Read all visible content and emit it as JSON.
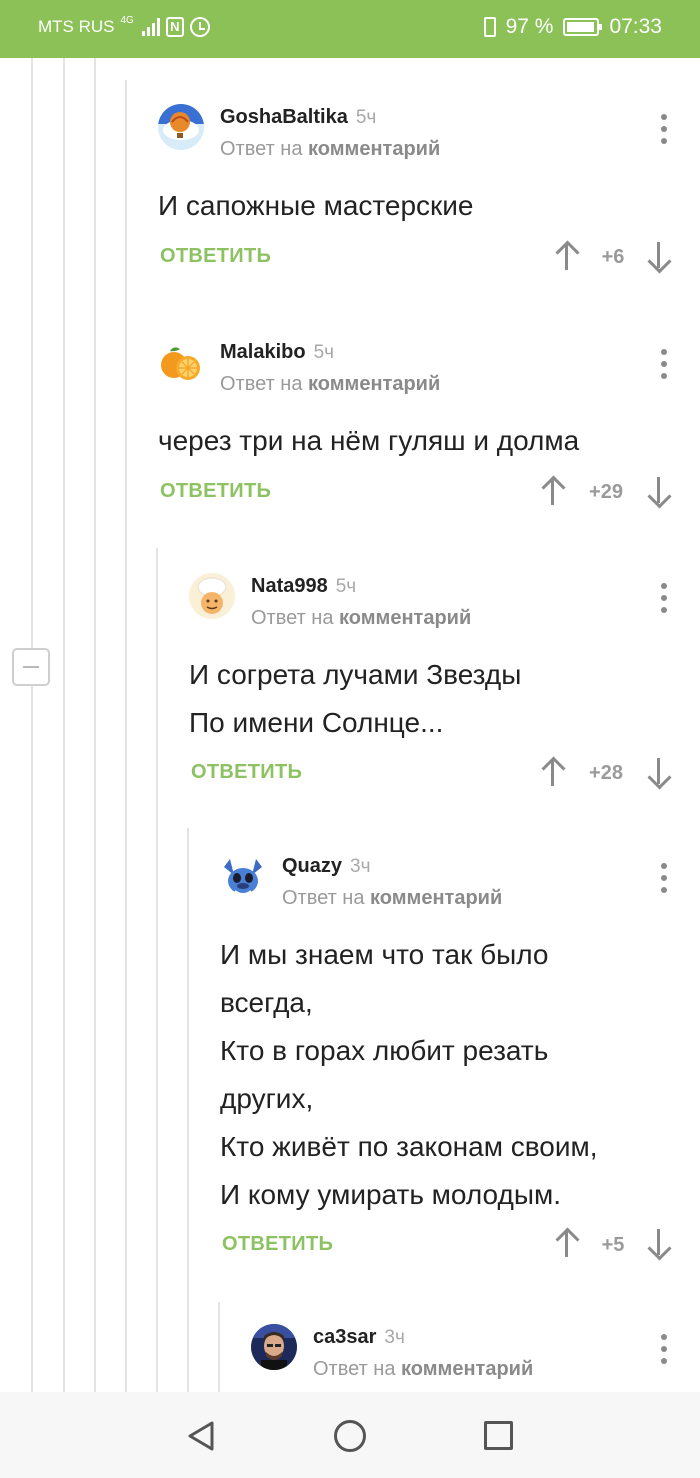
{
  "status": {
    "carrier": "MTS RUS",
    "network": "4G",
    "battery": "97 %",
    "time": "07:33"
  },
  "reply_prefix": "Ответ на",
  "reply_link": "комментарий",
  "reply_button": "ОТВЕТИТЬ",
  "comments": [
    {
      "user": "GoshaBaltika",
      "time": "5ч",
      "lines": [
        "И сапожные мастерские"
      ],
      "score": "+6",
      "avatar": "hot-air-balloon"
    },
    {
      "user": "Malakibo",
      "time": "5ч",
      "lines": [
        "через три на нём гуляш и долма"
      ],
      "score": "+29",
      "avatar": "orange-fruit"
    },
    {
      "user": "Nata998",
      "time": "5ч",
      "lines": [
        "И согрета лучами Звезды",
        "По имени Солнце..."
      ],
      "score": "+28",
      "avatar": "chef-hat"
    },
    {
      "user": "Quazy",
      "time": "3ч",
      "lines": [
        "И мы знаем что так было",
        "всегда,",
        "Кто в горах любит резать",
        "других,",
        "Кто живёт по законам своим,",
        "И кому умирать молодым."
      ],
      "score": "+5",
      "avatar": "stitch-character"
    },
    {
      "user": "ca3sar",
      "time": "3ч",
      "avatar": "man-portrait"
    }
  ]
}
